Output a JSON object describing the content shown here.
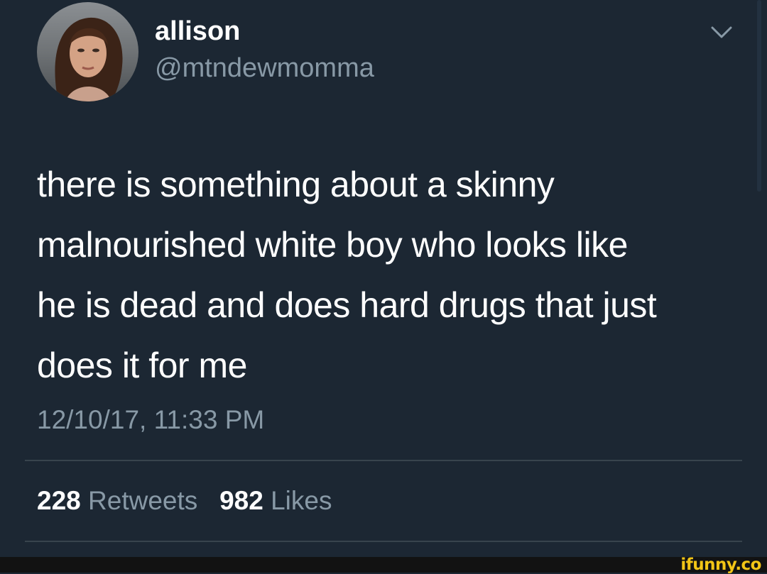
{
  "tweet": {
    "display_name": "allison",
    "handle": "@mtndewmomma",
    "text_lines": [
      "there is something about a skinny",
      "malnourished white boy who looks like",
      "he is dead and does hard drugs that just",
      "does it for me"
    ],
    "timestamp": "12/10/17, 11:33 PM",
    "retweets_count": "228",
    "retweets_label": "Retweets",
    "likes_count": "982",
    "likes_label": "Likes"
  },
  "footer": {
    "watermark": "ifunny.co"
  },
  "colors": {
    "background": "#1c2733",
    "secondary_text": "#8899a6",
    "divider": "#38444d",
    "watermark": "#f2c516"
  },
  "icons": {
    "menu": "chevron-down-icon"
  }
}
